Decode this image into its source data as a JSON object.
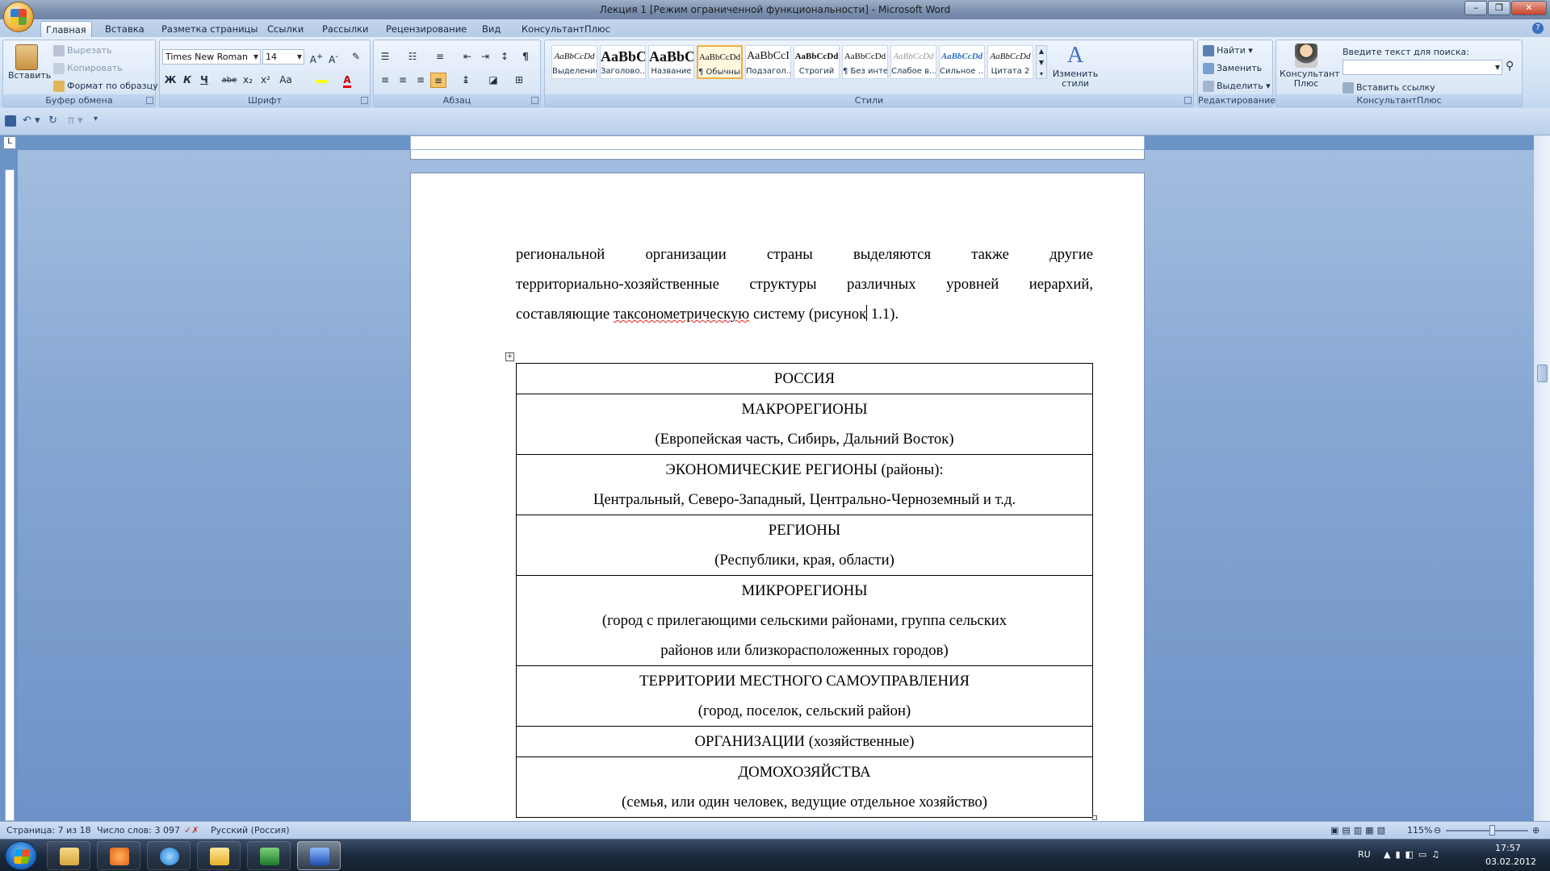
{
  "window": {
    "title": "Лекция 1 [Режим ограниченной функциональности] - Microsoft Word"
  },
  "tabs": [
    "Главная",
    "Вставка",
    "Разметка страницы",
    "Ссылки",
    "Рассылки",
    "Рецензирование",
    "Вид",
    "КонсультантПлюс"
  ],
  "ribbon": {
    "clipboard": {
      "label": "Буфер обмена",
      "paste": "Вставить",
      "cut": "Вырезать",
      "copy": "Копировать",
      "format_painter": "Формат по образцу"
    },
    "font": {
      "label": "Шрифт",
      "name": "Times New Roman",
      "size": "14",
      "bold": "Ж",
      "italic": "К",
      "underline": "Ч",
      "strike": "abe",
      "sub": "x₂",
      "sup": "x²",
      "case": "Aa"
    },
    "paragraph": {
      "label": "Абзац"
    },
    "styles": {
      "label": "Стили",
      "items": [
        {
          "preview": "AaBbCcDd",
          "name": "Выделение"
        },
        {
          "preview": "AaBbC",
          "name": "Заголово..."
        },
        {
          "preview": "AaBbC",
          "name": "Название"
        },
        {
          "preview": "AaBbCcDd",
          "name": "¶ Обычный"
        },
        {
          "preview": "AaBbCcI",
          "name": "Подзагол..."
        },
        {
          "preview": "AaBbCcDd",
          "name": "Строгий"
        },
        {
          "preview": "AaBbCcDd",
          "name": "¶ Без инте..."
        },
        {
          "preview": "AaBbCcDd",
          "name": "Слабое в..."
        },
        {
          "preview": "AaBbCcDd",
          "name": "Сильное ..."
        },
        {
          "preview": "AaBbCcDd",
          "name": "Цитата 2"
        }
      ],
      "change": "Изменить стили"
    },
    "editing": {
      "label": "Редактирование",
      "find": "Найти",
      "replace": "Заменить",
      "select": "Выделить"
    },
    "consultant": {
      "label": "КонсультантПлюс",
      "button": "Консультант Плюс",
      "search_label": "Введите текст для поиска:",
      "search_value": "",
      "insert_link": "Вставить ссылку"
    }
  },
  "document": {
    "para_lines": [
      "региональной организации страны выделяются также другие",
      "территориально-хозяйственные структуры различных уровней иерархий,"
    ],
    "para_last": {
      "a": "составляющие ",
      "spell": "таксонометрическую",
      "b": " систему (рисунок",
      "c": " 1.1)."
    },
    "table_rows": [
      [
        "РОССИЯ"
      ],
      [
        "МАКРОРЕГИОНЫ",
        "(Европейская часть, Сибирь, Дальний Восток)"
      ],
      [
        "ЭКОНОМИЧЕСКИЕ РЕГИОНЫ (районы):",
        "Центральный, Северо-Западный, Центрально-Черноземный и т.д."
      ],
      [
        "РЕГИОНЫ",
        "(Республики, края, области)"
      ],
      [
        "МИКРОРЕГИОНЫ",
        "(город с прилегающими сельскими районами, группа сельских",
        "районов или близкорасположенных городов)"
      ],
      [
        "ТЕРРИТОРИИ МЕСТНОГО САМОУПРАВЛЕНИЯ",
        "(город, поселок, сельский район)"
      ],
      [
        "ОРГАНИЗАЦИИ (хозяйственные)"
      ],
      [
        "ДОМОХОЗЯЙСТВА",
        "(семья, или один человек, ведущие отдельное хозяйство)"
      ]
    ]
  },
  "status": {
    "page": "Страница: 7 из 18",
    "words": "Число слов: 3 097",
    "language": "Русский (Россия)",
    "zoom": "115%"
  },
  "tray": {
    "lang": "RU",
    "time": "17:57",
    "date": "03.02.2012"
  },
  "colors": {
    "ribbon": "#dbe7f6",
    "workspace": "#86a7d3",
    "taskbar": "#1c2a3e"
  }
}
